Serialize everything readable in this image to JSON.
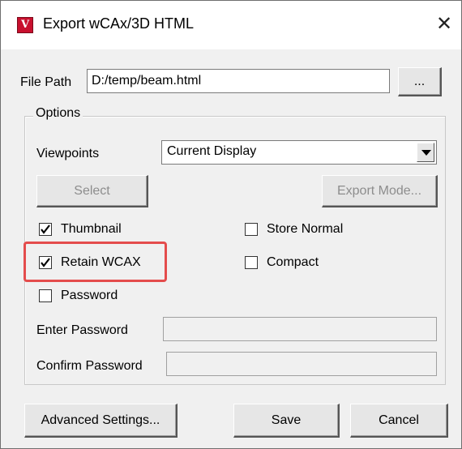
{
  "window": {
    "title": "Export wCAx/3D HTML",
    "icon_glyph": "V",
    "close_glyph": "✕"
  },
  "file_path": {
    "label": "File Path",
    "value": "D:/temp/beam.html",
    "browse_label": "..."
  },
  "options": {
    "group_label": "Options",
    "viewpoints_label": "Viewpoints",
    "viewpoints_value": "Current Display",
    "select_label": "Select",
    "export_mode_label": "Export Mode...",
    "checkboxes": {
      "thumbnail": {
        "label": "Thumbnail",
        "checked": true
      },
      "retain_wcax": {
        "label": "Retain WCAX",
        "checked": true
      },
      "password": {
        "label": "Password",
        "checked": false
      },
      "store_normal": {
        "label": "Store Normal",
        "checked": false
      },
      "compact": {
        "label": "Compact",
        "checked": false
      }
    },
    "enter_password_label": "Enter Password",
    "confirm_password_label": "Confirm Password",
    "enter_password_value": "",
    "confirm_password_value": ""
  },
  "footer": {
    "advanced_label": "Advanced Settings...",
    "save_label": "Save",
    "cancel_label": "Cancel"
  },
  "colors": {
    "highlight": "#e44c4c",
    "icon_red": "#c8102e",
    "dialog_bg": "#f0f0f0"
  }
}
